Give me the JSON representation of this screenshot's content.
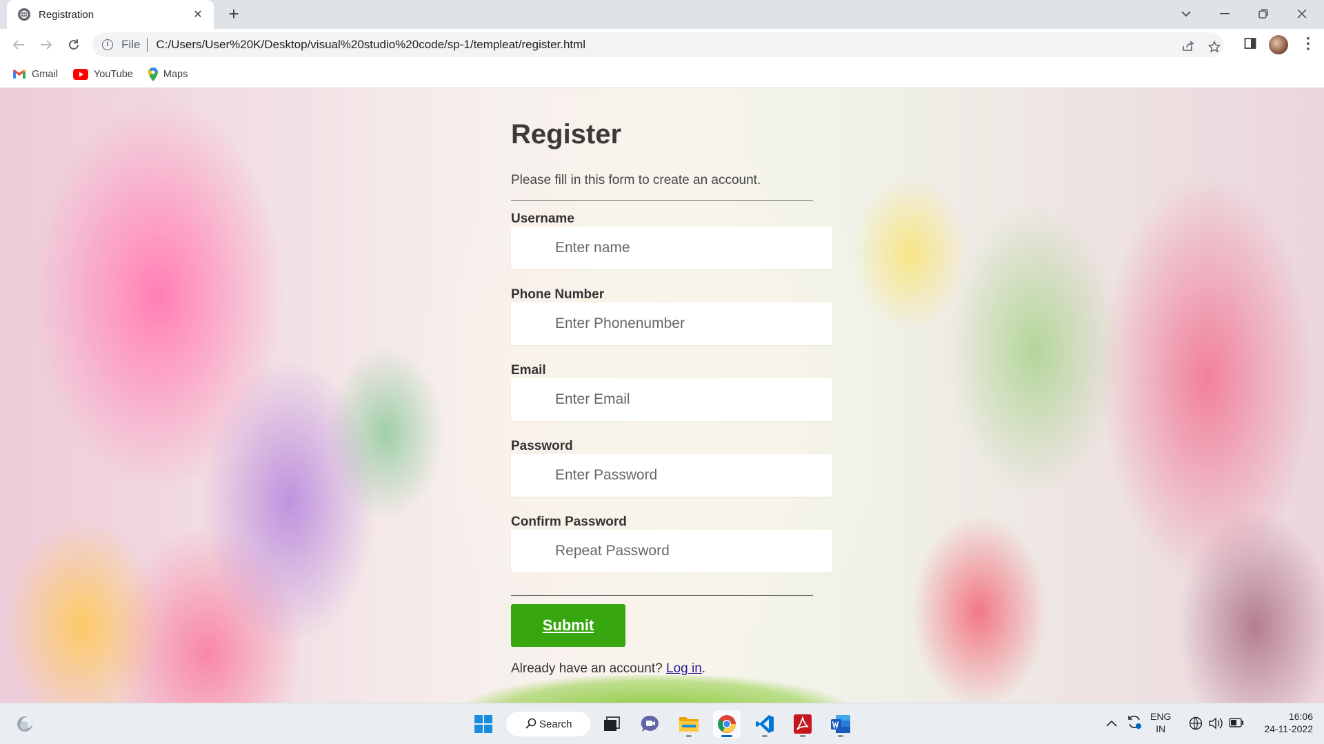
{
  "browser": {
    "tab_title": "Registration",
    "url_scheme": "File",
    "url": "C:/Users/User%20K/Desktop/visual%20studio%20code/sp-1/templeat/register.html",
    "bookmarks": [
      {
        "label": "Gmail",
        "icon": "gmail-icon"
      },
      {
        "label": "YouTube",
        "icon": "youtube-icon"
      },
      {
        "label": "Maps",
        "icon": "maps-icon"
      }
    ]
  },
  "form": {
    "title": "Register",
    "subtitle": "Please fill in this form to create an account.",
    "fields": [
      {
        "label": "Username",
        "placeholder": "Enter name"
      },
      {
        "label": "Phone Number",
        "placeholder": "Enter Phonenumber"
      },
      {
        "label": "Email",
        "placeholder": "Enter Email"
      },
      {
        "label": "Password",
        "placeholder": "Enter Password"
      },
      {
        "label": "Confirm Password",
        "placeholder": "Repeat Password"
      }
    ],
    "submit_label": "Submit",
    "login_prompt": "Already have an account?",
    "login_link": "Log in",
    "login_suffix": ".",
    "submit_color": "#3fa31a"
  },
  "taskbar": {
    "search_label": "Search",
    "apps": [
      "windows-start-icon",
      "search-icon",
      "task-view-icon",
      "teams-chat-icon",
      "file-explorer-icon",
      "chrome-icon",
      "vscode-icon",
      "acrobat-icon",
      "word-icon"
    ],
    "lang_top": "ENG",
    "lang_bottom": "IN",
    "time": "16:06",
    "date": "24-11-2022"
  }
}
